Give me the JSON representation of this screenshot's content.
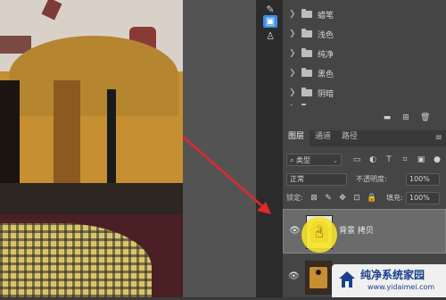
{
  "swatch_groups": {
    "items": [
      {
        "label": "蜡笔"
      },
      {
        "label": "浅色"
      },
      {
        "label": "纯净"
      },
      {
        "label": "黑色"
      },
      {
        "label": "阴暗"
      },
      {
        "label": "浅色"
      }
    ]
  },
  "layers_panel": {
    "tabs": [
      {
        "label": "图层"
      },
      {
        "label": "通道"
      },
      {
        "label": "路径"
      }
    ],
    "filter_kind": "类型",
    "blend_mode": "正常",
    "opacity_label": "不透明度:",
    "opacity_value": "100%",
    "lock_label": "锁定:",
    "fill_label": "填充:",
    "fill_value": "100%",
    "layers": [
      {
        "name": "背景 拷贝",
        "selected": true
      },
      {
        "name": "",
        "selected": false
      }
    ]
  },
  "watermark": {
    "title": "纯净系统家园",
    "url": "www.yidaimei.com"
  },
  "colors": {
    "annotation_arrow": "#e0282e",
    "cursor_highlight": "#f5e228",
    "toolbar_active": "#3d8ee3",
    "watermark_text": "#1a3f8f"
  },
  "icons": {
    "toolbar": [
      "note-icon",
      "stamp-icon",
      "puppet-warp-icon"
    ],
    "swatch_bottom": [
      "folder-icon",
      "new-swatch-icon",
      "trash-icon"
    ],
    "filters": [
      "image-filter-icon",
      "adjustment-filter-icon",
      "type-filter-icon",
      "shape-filter-icon",
      "smart-object-filter-icon",
      "filter-toggle-icon"
    ],
    "locks": [
      "lock-transparent-icon",
      "lock-paint-icon",
      "lock-move-icon",
      "lock-artboard-icon",
      "lock-all-icon"
    ]
  }
}
